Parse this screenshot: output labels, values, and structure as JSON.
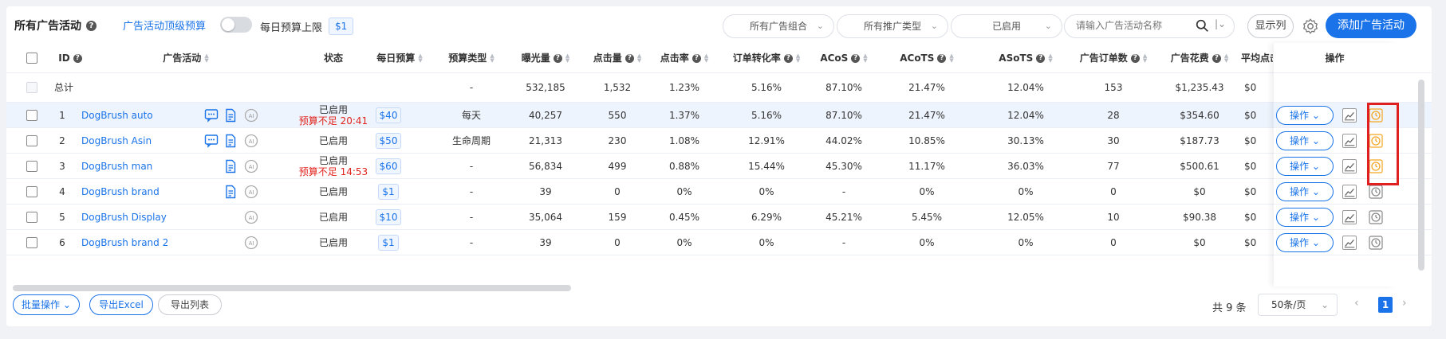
{
  "header": {
    "title": "所有广告活动",
    "budget_cap_link": "广告活动顶级预算",
    "daily_cap_label": "每日预算上限",
    "daily_cap_value": "$1",
    "filter_groups": "所有广告组合",
    "filter_types": "所有推广类型",
    "filter_status": "已启用",
    "search_placeholder": "请输入广告活动名称",
    "show_columns": "显示列",
    "add_campaign": "添加广告活动",
    "icons": [
      "help-icon",
      "search-icon",
      "gear-icon",
      "chevron-down-icon"
    ]
  },
  "table": {
    "columns": [
      "ID",
      "广告活动",
      "状态",
      "每日预算",
      "预算类型",
      "曝光量",
      "点击量",
      "点击率",
      "订单转化率",
      "ACoS",
      "ACoTS",
      "ASoTS",
      "广告订单数",
      "广告花费",
      "平均点击",
      "操作"
    ],
    "total_row": {
      "label": "总计",
      "budget_type": "-",
      "impressions": "532,185",
      "clicks": "1,532",
      "ctr": "1.23%",
      "cvr": "5.16%",
      "acos": "87.10%",
      "acots": "21.47%",
      "asots": "12.04%",
      "orders": "153",
      "spend": "$1,235.43",
      "cpc": "$0"
    },
    "rows": [
      {
        "id": "1",
        "name": "DogBrush auto",
        "status": "已启用",
        "status_note": "预算不足 20:41",
        "budget": "$40",
        "budget_type": "每天",
        "impressions": "40,257",
        "clicks": "550",
        "ctr": "1.37%",
        "cvr": "5.16%",
        "acos": "87.10%",
        "acots": "21.47%",
        "asots": "12.04%",
        "orders": "28",
        "spend": "$354.60",
        "cpc": "$0"
      },
      {
        "id": "2",
        "name": "DogBrush Asin",
        "status": "已启用",
        "status_note": "",
        "budget": "$50",
        "budget_type": "生命周期",
        "impressions": "21,313",
        "clicks": "230",
        "ctr": "1.08%",
        "cvr": "12.91%",
        "acos": "44.02%",
        "acots": "10.85%",
        "asots": "30.13%",
        "orders": "30",
        "spend": "$187.73",
        "cpc": "$0"
      },
      {
        "id": "3",
        "name": "DogBrush man",
        "status": "已启用",
        "status_note": "预算不足 14:53",
        "budget": "$60",
        "budget_type": "-",
        "impressions": "56,834",
        "clicks": "499",
        "ctr": "0.88%",
        "cvr": "15.44%",
        "acos": "45.30%",
        "acots": "11.17%",
        "asots": "36.03%",
        "orders": "77",
        "spend": "$500.61",
        "cpc": "$0"
      },
      {
        "id": "4",
        "name": "DogBrush brand",
        "status": "已启用",
        "status_note": "",
        "budget": "$1",
        "budget_type": "-",
        "impressions": "39",
        "clicks": "0",
        "ctr": "0%",
        "cvr": "0%",
        "acos": "-",
        "acots": "0%",
        "asots": "0%",
        "orders": "0",
        "spend": "$0",
        "cpc": "$0"
      },
      {
        "id": "5",
        "name": "DogBrush Display",
        "status": "已启用",
        "status_note": "",
        "budget": "$10",
        "budget_type": "-",
        "impressions": "35,064",
        "clicks": "159",
        "ctr": "0.45%",
        "cvr": "6.29%",
        "acos": "45.21%",
        "acots": "5.45%",
        "asots": "12.05%",
        "orders": "10",
        "spend": "$90.38",
        "cpc": "$0"
      },
      {
        "id": "6",
        "name": "DogBrush brand 2",
        "status": "已启用",
        "status_note": "",
        "budget": "$1",
        "budget_type": "-",
        "impressions": "39",
        "clicks": "0",
        "ctr": "0%",
        "cvr": "0%",
        "acos": "-",
        "acots": "0%",
        "asots": "0%",
        "orders": "0",
        "spend": "$0",
        "cpc": "$0"
      }
    ],
    "action_label": "操作"
  },
  "footer": {
    "bulk": "批量操作",
    "export_excel": "导出Excel",
    "export_list": "导出列表",
    "total": "共 9 条",
    "page_size": "50条/页",
    "current_page": "1",
    "prev": "‹",
    "next": "›"
  },
  "colors": {
    "accent": "#1a73e8",
    "warning": "#e0231c",
    "highlight": "#e02020",
    "clock_active": "#f5a623"
  }
}
